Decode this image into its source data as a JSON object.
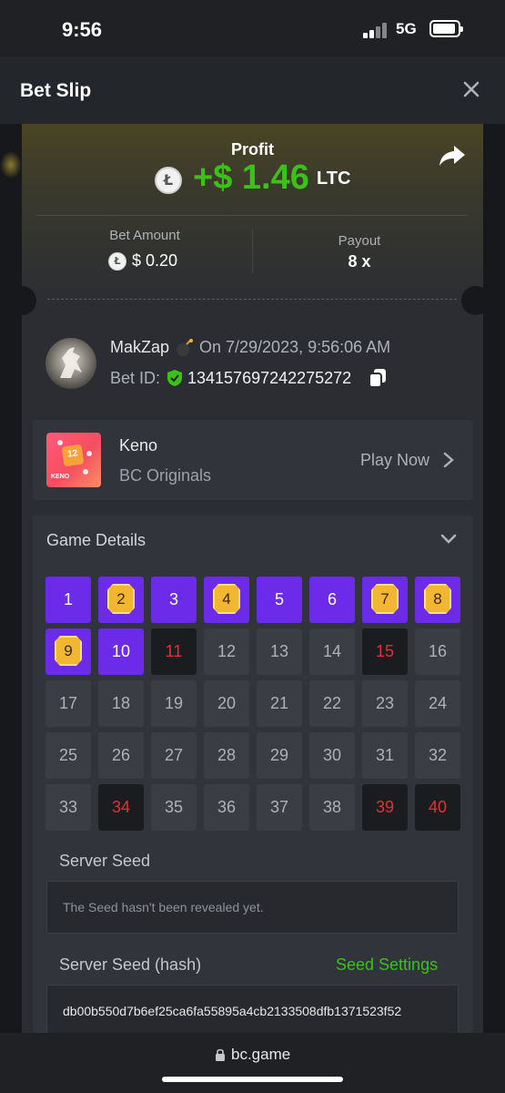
{
  "status_bar": {
    "time": "9:56",
    "network": "5G"
  },
  "header": {
    "title": "Bet Slip"
  },
  "profit": {
    "label": "Profit",
    "amount": "+$ 1.46",
    "currency": "LTC"
  },
  "bet": {
    "amount_label": "Bet Amount",
    "amount_value": "$ 0.20",
    "payout_label": "Payout",
    "payout_value": "8 x"
  },
  "user": {
    "name": "MakZap",
    "date": "On 7/29/2023, 9:56:06 AM",
    "bet_id_label": "Bet ID:",
    "bet_id": "134157697242275272"
  },
  "game": {
    "name": "Keno",
    "provider": "BC Originals",
    "play_label": "Play Now",
    "thumb_label": "KENO",
    "thumb_number": "12"
  },
  "details": {
    "title": "Game Details",
    "cells": [
      {
        "n": "1",
        "state": "selected"
      },
      {
        "n": "2",
        "state": "hit"
      },
      {
        "n": "3",
        "state": "selected"
      },
      {
        "n": "4",
        "state": "hit"
      },
      {
        "n": "5",
        "state": "selected"
      },
      {
        "n": "6",
        "state": "selected"
      },
      {
        "n": "7",
        "state": "hit"
      },
      {
        "n": "8",
        "state": "hit"
      },
      {
        "n": "9",
        "state": "hit"
      },
      {
        "n": "10",
        "state": "selected"
      },
      {
        "n": "11",
        "state": "drawn"
      },
      {
        "n": "12",
        "state": "none"
      },
      {
        "n": "13",
        "state": "none"
      },
      {
        "n": "14",
        "state": "none"
      },
      {
        "n": "15",
        "state": "drawn"
      },
      {
        "n": "16",
        "state": "none"
      },
      {
        "n": "17",
        "state": "none"
      },
      {
        "n": "18",
        "state": "none"
      },
      {
        "n": "19",
        "state": "none"
      },
      {
        "n": "20",
        "state": "none"
      },
      {
        "n": "21",
        "state": "none"
      },
      {
        "n": "22",
        "state": "none"
      },
      {
        "n": "23",
        "state": "none"
      },
      {
        "n": "24",
        "state": "none"
      },
      {
        "n": "25",
        "state": "none"
      },
      {
        "n": "26",
        "state": "none"
      },
      {
        "n": "27",
        "state": "none"
      },
      {
        "n": "28",
        "state": "none"
      },
      {
        "n": "29",
        "state": "none"
      },
      {
        "n": "30",
        "state": "none"
      },
      {
        "n": "31",
        "state": "none"
      },
      {
        "n": "32",
        "state": "none"
      },
      {
        "n": "33",
        "state": "none"
      },
      {
        "n": "34",
        "state": "drawn"
      },
      {
        "n": "35",
        "state": "none"
      },
      {
        "n": "36",
        "state": "none"
      },
      {
        "n": "37",
        "state": "none"
      },
      {
        "n": "38",
        "state": "none"
      },
      {
        "n": "39",
        "state": "drawn"
      },
      {
        "n": "40",
        "state": "drawn"
      }
    ],
    "server_seed_label": "Server Seed",
    "server_seed_value": "The Seed hasn't been revealed yet.",
    "hash_label": "Server Seed (hash)",
    "seed_settings_label": "Seed Settings",
    "hash_value": "db00b550d7b6ef25ca6fa55895a4cb2133508dfb1371523f52"
  },
  "browser": {
    "url": "bc.game"
  },
  "colors": {
    "accent_green": "#3bc117",
    "selected_purple": "#6b2be8",
    "miss_red": "#e23232",
    "gem_gold": "#f2b632"
  }
}
